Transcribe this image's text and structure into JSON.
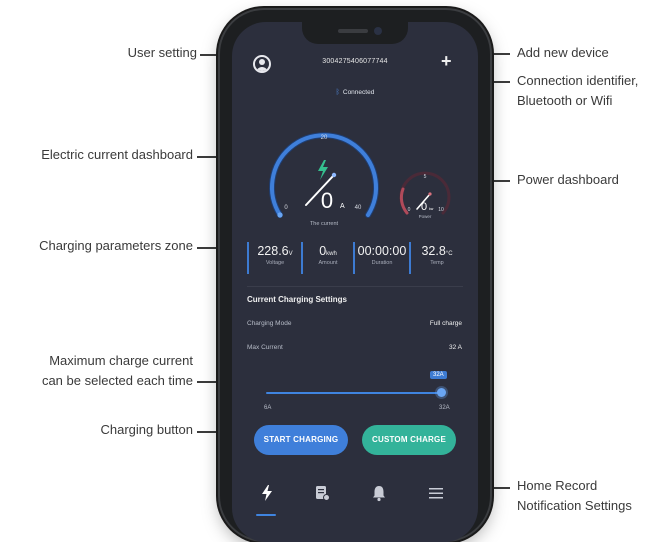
{
  "callouts": {
    "user_setting": "User setting",
    "add_device": "Add new device",
    "connection_line1": "Connection identifier,",
    "connection_line2": "Bluetooth or Wifi",
    "current_dashboard": "Electric current dashboard",
    "power_dashboard": "Power dashboard",
    "params_zone": "Charging parameters zone",
    "max_current_line1": "Maximum charge current",
    "max_current_line2": "can be selected each time",
    "charging_button": "Charging button",
    "tabs_line1": "Home  Record",
    "tabs_line2": "Notification  Settings"
  },
  "header": {
    "device_id": "3004275406077744",
    "add_symbol": "+",
    "connection_icon": "bluetooth-icon",
    "connection_status": "Connected"
  },
  "current_gauge": {
    "value": "0",
    "unit": "A",
    "label": "The current",
    "min_label": "0",
    "mid_label": "20",
    "max_label": "40",
    "needle_fraction": 0.0
  },
  "power_gauge": {
    "value": "0",
    "unit": "kw",
    "label": "Power",
    "min_label": "0",
    "mid_label": "5",
    "max_label": "10",
    "needle_fraction": 0.0
  },
  "params": [
    {
      "value": "228.6",
      "unit": "V",
      "label": "Voltage"
    },
    {
      "value": "0",
      "unit": "kwh",
      "label": "Amount"
    },
    {
      "value": "00:00:00",
      "unit": "",
      "label": "Duration"
    },
    {
      "value": "32.8",
      "unit": "°C",
      "label": "Temp"
    }
  ],
  "settings": {
    "title": "Current Charging Settings",
    "mode_label": "Charging Mode",
    "mode_value": "Full charge",
    "max_label": "Max Current",
    "max_value": "32 A"
  },
  "slider": {
    "min_label": "6A",
    "max_label": "32A",
    "tooltip": "32A",
    "value_fraction": 1.0
  },
  "buttons": {
    "start": "START CHARGING",
    "custom": "CUSTOM CHARGE"
  },
  "tabs": [
    {
      "icon": "lightning-icon",
      "active": true
    },
    {
      "icon": "record-icon",
      "active": false
    },
    {
      "icon": "bell-icon",
      "active": false
    },
    {
      "icon": "menu-icon",
      "active": false
    }
  ],
  "colors": {
    "screen_bg": "#2c2f3d",
    "accent_blue": "#3f7fda",
    "accent_green": "#33b39a",
    "power_arc": "#b04a5a"
  }
}
